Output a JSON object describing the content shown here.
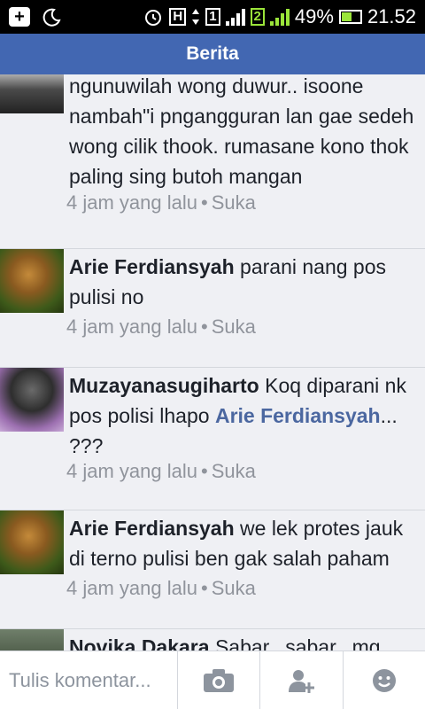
{
  "status_bar": {
    "battery": "49%",
    "time": "21.52",
    "network_h": "H",
    "sim1": "1",
    "sim2": "2"
  },
  "header": {
    "title": "Berita"
  },
  "comments": [
    {
      "name": "",
      "text": "ngunuwilah wong duwur.. isoone nambah\"i pngangguran lan gae sedeh wong cilik thook. rumasane kono thok paling sing butoh mangan",
      "time": "4 jam yang lalu",
      "like": "Suka"
    },
    {
      "name": "Arie Ferdiansyah",
      "text": "parani nang pos pulisi no",
      "time": "4 jam yang lalu",
      "like": "Suka"
    },
    {
      "name": "Muzayanasugiharto",
      "text_before": "Koq diparani nk pos polisi lhapo",
      "mention": "Arie Ferdiansyah",
      "text_after": "... ???",
      "time": "4 jam yang lalu",
      "like": "Suka"
    },
    {
      "name": "Arie Ferdiansyah",
      "text": "we lek protes jauk di terno pulisi ben gak salah paham",
      "time": "4 jam yang lalu",
      "like": "Suka"
    },
    {
      "name": "Novika Dakara",
      "text": "Sabar.. sabar.. mg"
    }
  ],
  "composer": {
    "placeholder": "Tulis komentar..."
  },
  "separator_dot": "•",
  "icons": [
    "camera-icon",
    "tag-friend-icon",
    "emoji-icon"
  ],
  "colors": {
    "header": "#4267b2",
    "mention": "#4b67a0",
    "meta": "#90949c"
  }
}
